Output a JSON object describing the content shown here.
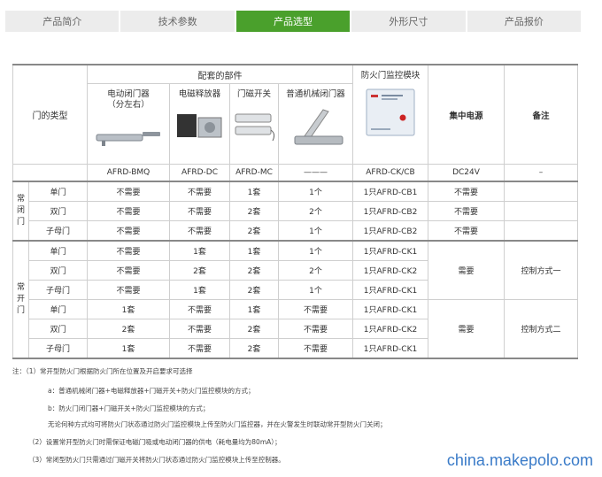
{
  "tabs": [
    {
      "label": "产品简介",
      "active": false
    },
    {
      "label": "技术参数",
      "active": false
    },
    {
      "label": "产品选型",
      "active": true
    },
    {
      "label": "外形尺寸",
      "active": false
    },
    {
      "label": "产品报价",
      "active": false
    }
  ],
  "table": {
    "door_type_header": "门的类型",
    "group_header": "配套的部件",
    "components": [
      {
        "label": "电动闭门器\n（分左右）",
        "model": "AFRD-BMQ",
        "icon": "door-closer-icon"
      },
      {
        "label": "电磁释放器",
        "model": "AFRD-DC",
        "icon": "magnetic-holder-icon"
      },
      {
        "label": "门磁开关",
        "model": "AFRD-MC",
        "icon": "door-magnet-switch-icon"
      },
      {
        "label": "普通机械闭门器",
        "model": "———",
        "icon": "mechanical-closer-icon"
      },
      {
        "label": "防火门监控模块",
        "model": "AFRD-CK/CB",
        "icon": "monitor-module-icon"
      }
    ],
    "power_header": "集中电源",
    "power_model": "DC24V",
    "remark_header": "备注",
    "remark_model": "–",
    "groups": [
      {
        "label": "常\n闭\n门",
        "rows": [
          {
            "door": "单门",
            "c1": "不需要",
            "c2": "不需要",
            "c3": "1套",
            "c4": "1个",
            "c5": "1只AFRD-CB1",
            "power": "不需要"
          },
          {
            "door": "双门",
            "c1": "不需要",
            "c2": "不需要",
            "c3": "2套",
            "c4": "2个",
            "c5": "1只AFRD-CB2",
            "power": "不需要"
          },
          {
            "door": "子母门",
            "c1": "不需要",
            "c2": "不需要",
            "c3": "2套",
            "c4": "1个",
            "c5": "1只AFRD-CB2",
            "power": "不需要"
          }
        ]
      },
      {
        "label": "常\n开\n门",
        "rows": [
          {
            "door": "单门",
            "c1": "不需要",
            "c2": "1套",
            "c3": "1套",
            "c4": "1个",
            "c5": "1只AFRD-CK1"
          },
          {
            "door": "双门",
            "c1": "不需要",
            "c2": "2套",
            "c3": "2套",
            "c4": "2个",
            "c5": "1只AFRD-CK2"
          },
          {
            "door": "子母门",
            "c1": "不需要",
            "c2": "1套",
            "c3": "2套",
            "c4": "1个",
            "c5": "1只AFRD-CK1"
          },
          {
            "door": "单门",
            "c1": "1套",
            "c2": "不需要",
            "c3": "1套",
            "c4": "不需要",
            "c5": "1只AFRD-CK1"
          },
          {
            "door": "双门",
            "c1": "2套",
            "c2": "不需要",
            "c3": "2套",
            "c4": "不需要",
            "c5": "1只AFRD-CK2"
          },
          {
            "door": "子母门",
            "c1": "1套",
            "c2": "不需要",
            "c3": "2套",
            "c4": "不需要",
            "c5": "1只AFRD-CK1"
          }
        ],
        "merged": [
          {
            "power": "需要",
            "remark": "控制方式一"
          },
          {
            "power": "需要",
            "remark": "控制方式二"
          }
        ]
      }
    ]
  },
  "notes": [
    "注：（1）常开型防火门根据防火门所在位置及开启要求可选择",
    "a：普通机械闭门器+电磁释放器+门磁开关+防火门监控模块的方式；",
    "b：防火门闭门器+门磁开关+防火门监控模块的方式；",
    "无论何种方式均可将防火门状态通过防火门监控模块上传至防火门监控器，并在火警发生时联动常开型防火门关闭；",
    "（2）设置常开型防火门时需保证电磁门吸或电动闭门器的供电（耗电量均为80mA）；",
    "（3）常闭型防火门只需通过门磁开关将防火门状态通过防火门监控模块上传至控制器。"
  ],
  "watermark": "china.makepolo.com"
}
